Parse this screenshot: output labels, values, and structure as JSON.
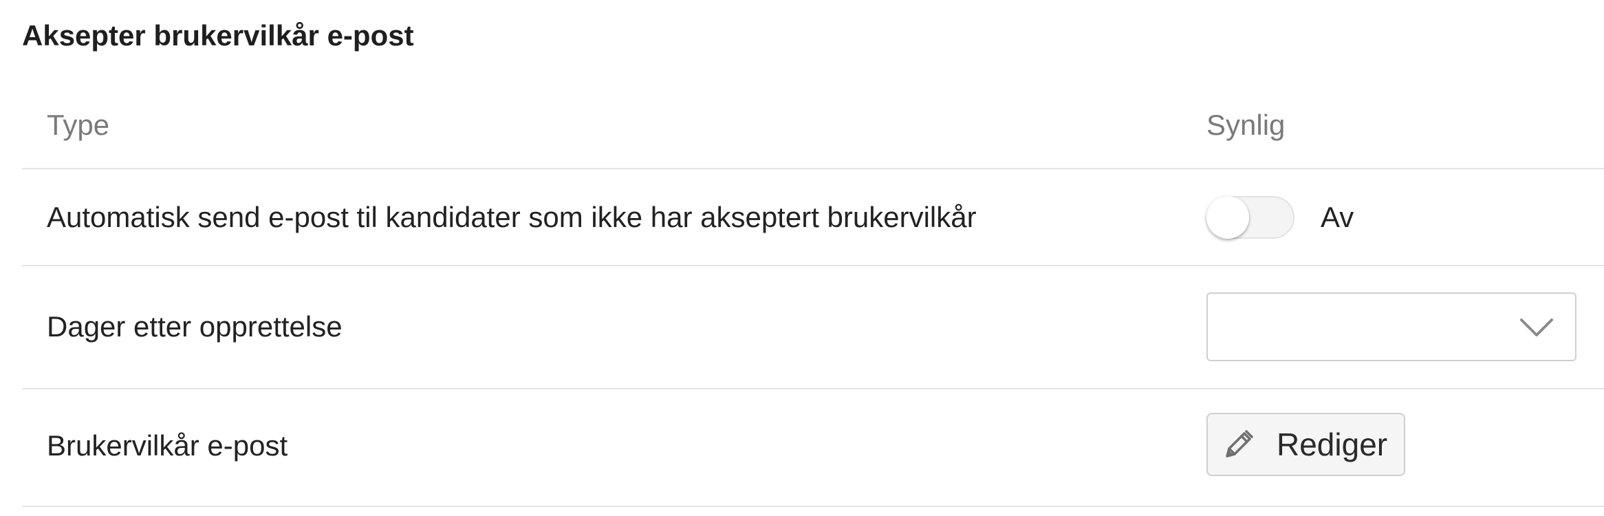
{
  "section": {
    "title": "Aksepter brukervilkår e-post"
  },
  "table": {
    "headers": {
      "type": "Type",
      "visible": "Synlig"
    },
    "rows": [
      {
        "type": "Automatisk send e-post til kandidater som ikke har akseptert brukervilkår",
        "control": "toggle",
        "toggle_state": "off",
        "toggle_label": "Av"
      },
      {
        "type": "Dager etter opprettelse",
        "control": "select",
        "selected_value": ""
      },
      {
        "type": "Brukervilkår e-post",
        "control": "button",
        "button_label": "Rediger",
        "button_icon": "pencil-icon"
      }
    ]
  },
  "colors": {
    "header_text": "#7a7a7a",
    "body_text": "#222222",
    "divider": "#e4e4e4",
    "button_bg": "#f5f5f5",
    "border": "#cfcfcf"
  }
}
